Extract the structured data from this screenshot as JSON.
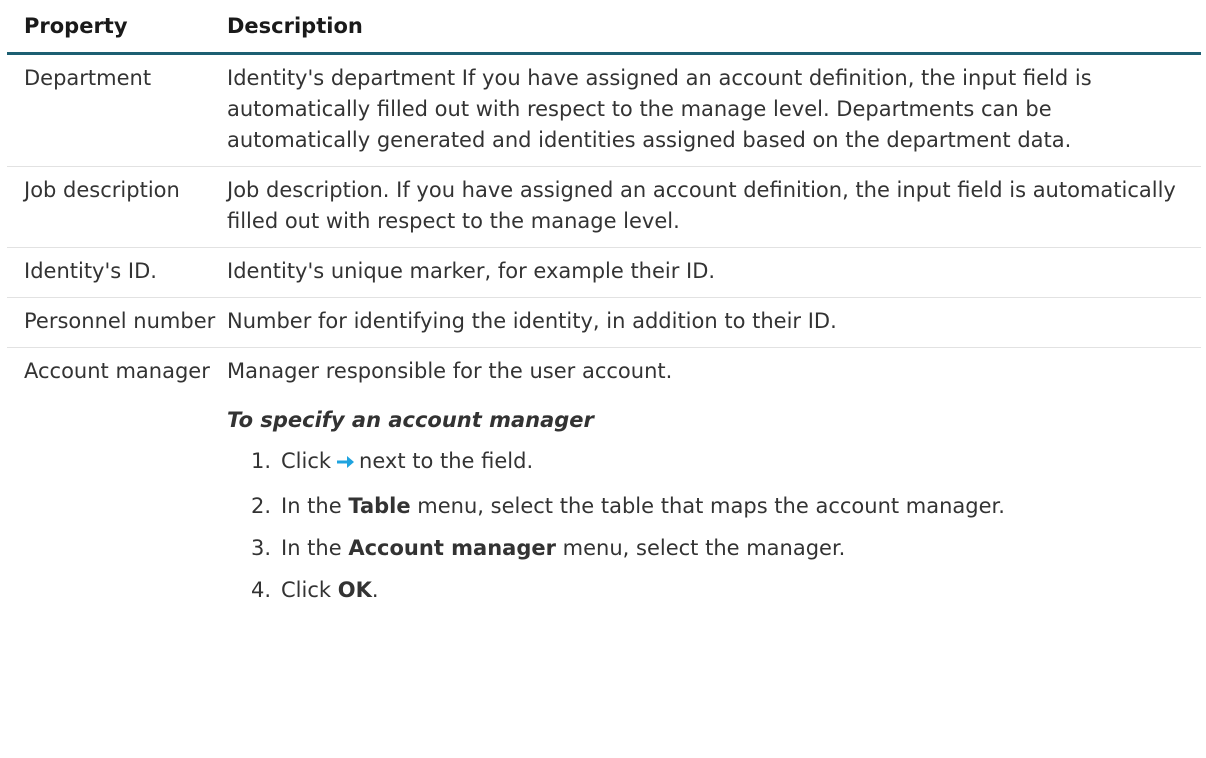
{
  "header": {
    "property": "Property",
    "description": "Description"
  },
  "rows": [
    {
      "property": "Department",
      "description": "Identity's department If you have assigned an account definition, the input field is automatically filled out with respect to the manage level. Departments can be automatically generated and identities assigned based on the department data."
    },
    {
      "property": "Job description",
      "description": "Job description. If you have assigned an account definition, the input field is automatically filled out with respect to the manage level."
    },
    {
      "property": "Identity's ID.",
      "description": "Identity's unique marker, for example their ID."
    },
    {
      "property": "Personnel number",
      "description": "Number for identifying the identity, in addition to their ID."
    },
    {
      "property": "Account manager",
      "description": "Manager responsible for the user account.",
      "procedure_title": "To specify an account manager",
      "steps": [
        {
          "num": "1.",
          "pre": "Click",
          "post": "next to the field."
        },
        {
          "num": "2.",
          "pre": "In the",
          "bold": "Table",
          "post": "menu, select the table that maps the account manager."
        },
        {
          "num": "3.",
          "pre": "In the",
          "bold": "Account manager",
          "post": "menu, select the manager."
        },
        {
          "num": "4.",
          "pre": "Click",
          "bold": "OK",
          "post": "."
        }
      ]
    }
  ],
  "icons": {
    "arrow": "arrow-right-icon",
    "arrow_color": "#1ea3df"
  },
  "colors": {
    "header_rule": "#1d5f72",
    "row_divider": "#e2e2e2",
    "text": "#333333"
  }
}
